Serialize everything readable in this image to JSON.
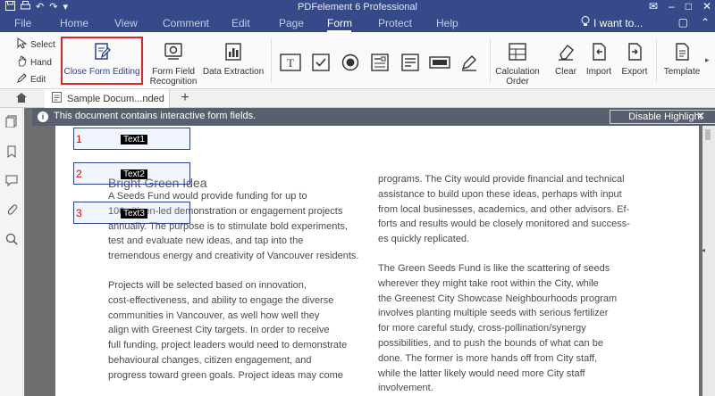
{
  "titlebar": {
    "title": "PDFelement 6 Professional",
    "controls": [
      "✉",
      "–",
      "□",
      "✕"
    ]
  },
  "menu": {
    "tabs": [
      "File",
      "Home",
      "View",
      "Comment",
      "Edit",
      "Page",
      "Form",
      "Protect",
      "Help"
    ],
    "active": "Form",
    "i_want": "I want to..."
  },
  "ribbon": {
    "select": "Select",
    "hand": "Hand",
    "edit": "Edit",
    "close_form_editing": "Close Form Editing",
    "form_field_recognition_1": "Form Field",
    "form_field_recognition_2": "Recognition",
    "data_extraction": "Data Extraction",
    "calc_order_1": "Calculation",
    "calc_order_2": "Order",
    "clear": "Clear",
    "import": "Import",
    "export": "Export",
    "template": "Template"
  },
  "doc_tab": {
    "name": "Sample Docum...nded",
    "new_tab": "+"
  },
  "infobar": {
    "message": "This document contains interactive form fields.",
    "button": "Disable Highlight",
    "close": "✕"
  },
  "form_fields": [
    {
      "number": "1",
      "label": "Text1"
    },
    {
      "number": "2",
      "label": "Text2"
    },
    {
      "number": "3",
      "label": "Text3"
    }
  ],
  "document": {
    "heading": "Bright Green Idea",
    "col_a_para1": [
      "A         Seeds Fund would provide funding for up to",
      "100 citizen-led demonstration or engagement projects",
      "annually. The purpose is to stimulate bold experiments,",
      "test and evaluate new ideas, and tap into the",
      "tremendous energy and creativity of Vancouver residents."
    ],
    "col_a_para2": [
      "Projects will be selected based on innovation,",
      "cost-effectiveness, and ability to engage the diverse",
      "communities in Vancouver, as well how well they",
      "align with Greenest City targets. In order to receive",
      "full funding, project leaders would need to demonstrate",
      "behavioural changes, citizen engagement, and",
      "progress toward green goals. Project ideas may come"
    ],
    "col_b_para1": [
      "programs. The City would provide financial and technical",
      "assistance to build upon these ideas, perhaps with input",
      "from local businesses, academics, and other advisors. Ef-",
      "forts and results would be closely monitored and success-",
      "es quickly replicated."
    ],
    "col_b_para2": [
      "The Green Seeds Fund is like the scattering of seeds",
      "wherever they might take root within the City, while",
      "the Greenest City Showcase Neighbourhoods program",
      "involves planting multiple seeds with serious fertilizer",
      "for more careful study, cross-pollination/synergy",
      "possibilities, and to push the bounds of what can be",
      "done. The former is more hands off from City staff,",
      "while the latter likely would need more City staff",
      "involvement."
    ]
  },
  "colors": {
    "titlebar": "#364a8a",
    "highlight": "#e02424",
    "field_border": "#2d3f8f",
    "infobar": "#586070"
  }
}
